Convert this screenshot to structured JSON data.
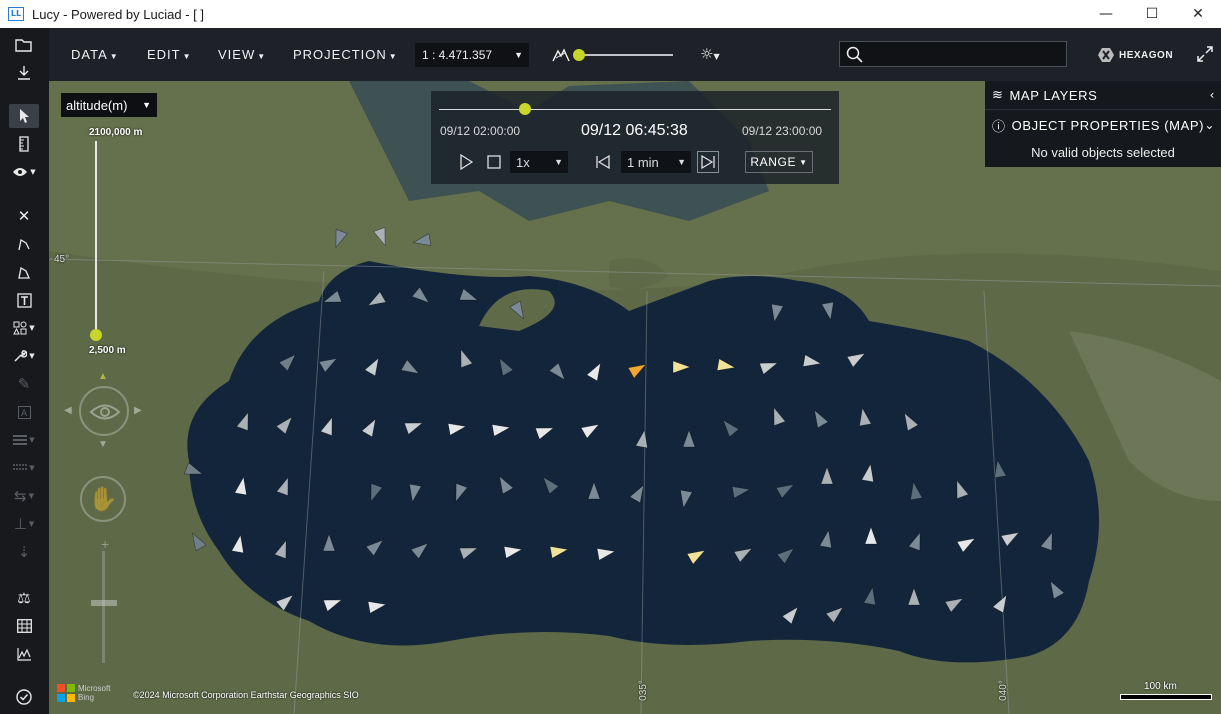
{
  "window": {
    "title": "Lucy - Powered by Luciad - [ ]",
    "app_icon_text": "LL",
    "minimize": "—",
    "maximize": "☐",
    "close": "✕"
  },
  "menu": {
    "items": [
      "DATA",
      "EDIT",
      "VIEW",
      "PROJECTION"
    ],
    "scale_value": "1 : 4.471.357",
    "brand": "HEXAGON",
    "search_placeholder": ""
  },
  "altitude": {
    "unit_option": "altitude(m)",
    "max_label": "2100,000 m",
    "min_label": "2,500 m",
    "slider_fraction": 1.0
  },
  "timeline": {
    "start": "09/12 02:00:00",
    "current": "09/12 06:45:38",
    "end": "09/12 23:00:00",
    "progress_fraction": 0.22,
    "speed": "1x",
    "step": "1 min",
    "range_label": "RANGE"
  },
  "panels": {
    "map_layers": "MAP LAYERS",
    "object_properties": "OBJECT PROPERTIES (MAP)",
    "no_selection": "No valid objects selected"
  },
  "map": {
    "attribution": "©2024 Microsoft Corporation   Earthstar Geographics   SIO",
    "bing_text_1": "Microsoft",
    "bing_text_2": "Bing",
    "scale_bar_label": "100 km",
    "grid_labels": {
      "lat_45": "45°",
      "lon_35": "035°",
      "lon_40": "040°"
    }
  },
  "colors": {
    "accent": "#c8d62b",
    "sea": "#13253b",
    "land": "#5f6b48",
    "highlight_orange": "#f0a830",
    "highlight_yellow": "#f1e29a"
  }
}
